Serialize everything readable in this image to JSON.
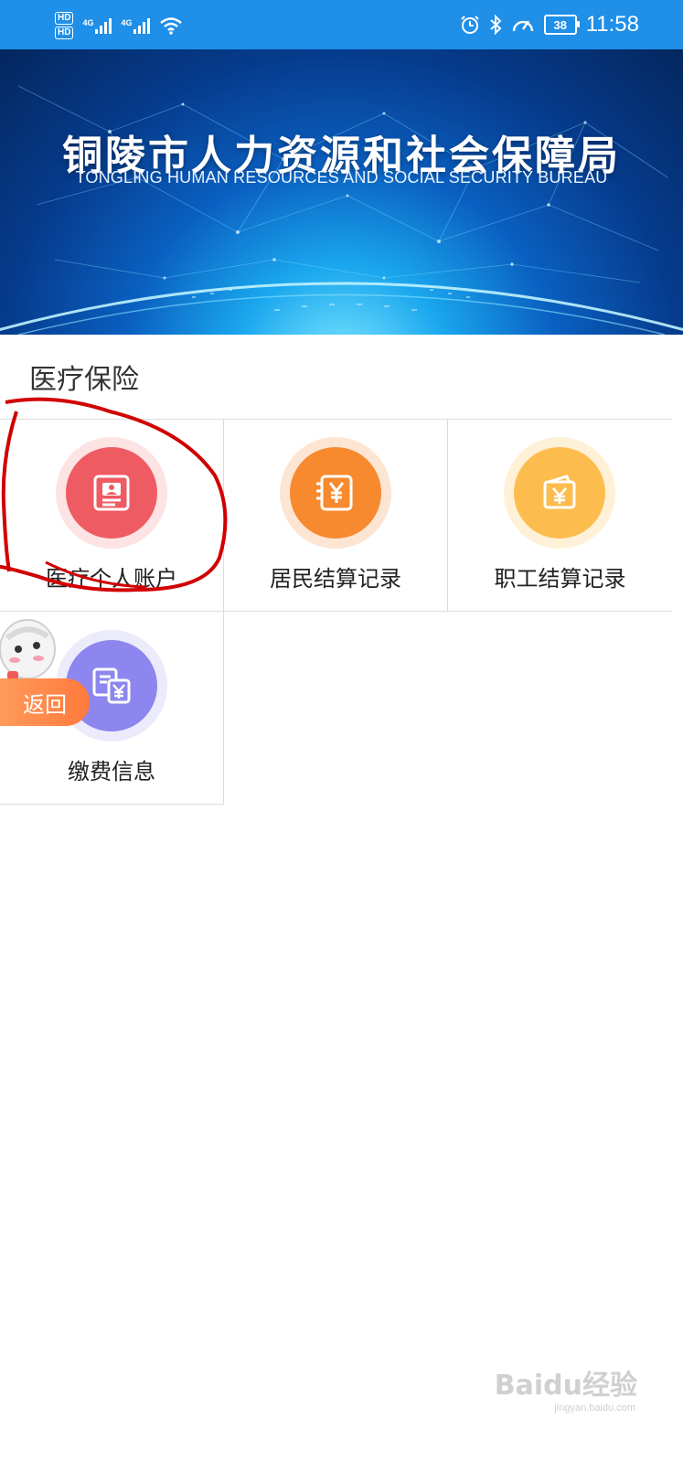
{
  "status_bar": {
    "hd1": "HD",
    "hd2": "HD",
    "net1": "4G",
    "net2": "4G",
    "battery": "38",
    "time": "11:58"
  },
  "banner": {
    "title": "铜陵市人力资源和社会保障局",
    "subtitle": "TONGLING HUMAN RESOURCES AND SOCIAL SECURITY BUREAU"
  },
  "section": {
    "title": "医疗保险",
    "items": [
      {
        "label": "医疗个人账户",
        "icon": "id-card-icon",
        "color": "#ef5b62"
      },
      {
        "label": "居民结算记录",
        "icon": "yen-receipt-icon",
        "color": "#f78a2f"
      },
      {
        "label": "职工结算记录",
        "icon": "wallet-yen-icon",
        "color": "#fdbd4e"
      },
      {
        "label": "缴费信息",
        "icon": "payment-docs-icon",
        "color": "#8c86ee"
      }
    ]
  },
  "back_button": {
    "label": "返回"
  },
  "watermark": {
    "text": "Baidu经验",
    "url": "jingyan.baidu.com"
  }
}
